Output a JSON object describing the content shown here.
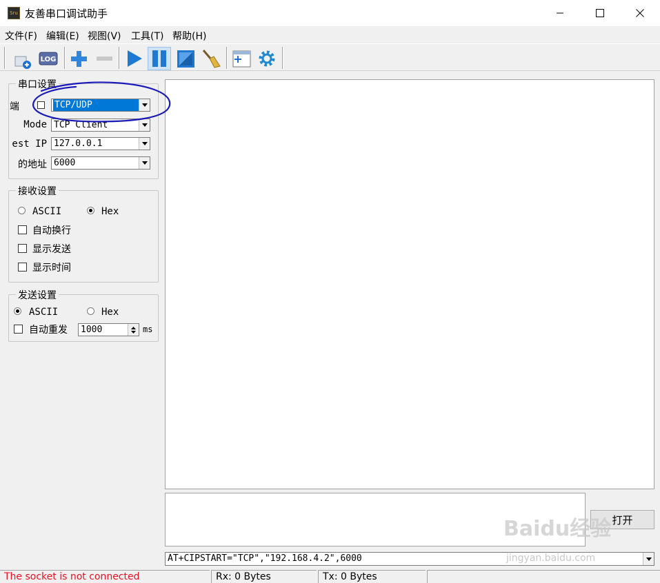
{
  "window": {
    "title": "友善串口调试助手",
    "icon_text": "Sru"
  },
  "menu": {
    "items": [
      "文件(F)",
      "编辑(E)",
      "视图(V)",
      "工具(T)",
      "帮助(H)"
    ]
  },
  "toolbar": {
    "icons": [
      "new-window-icon",
      "log-icon",
      "plus-icon",
      "minus-icon",
      "play-icon",
      "pause-icon",
      "window-icon",
      "broom-icon",
      "layout-icon",
      "settings-gear-icon"
    ],
    "log_label": "LOG"
  },
  "serial_settings": {
    "title": "串口设置",
    "port_label": "端",
    "port_value": "TCP/UDP",
    "mode_label": "Mode",
    "mode_value": "TCP Client",
    "ip_label": "est IP",
    "ip_value": "127.0.0.1",
    "addr_label": "的地址",
    "addr_value": "6000"
  },
  "receive_settings": {
    "title": "接收设置",
    "ascii_label": "ASCII",
    "hex_label": "Hex",
    "selected": "Hex",
    "auto_wrap": "自动换行",
    "show_send": "显示发送",
    "show_time": "显示时间"
  },
  "send_settings": {
    "title": "发送设置",
    "ascii_label": "ASCII",
    "hex_label": "Hex",
    "selected": "ASCII",
    "auto_resend": "自动重发",
    "interval_value": "1000",
    "interval_unit": "ms"
  },
  "main": {
    "open_button": "打开",
    "command_value": "AT+CIPSTART=\"TCP\",\"192.168.4.2\",6000"
  },
  "status": {
    "message": "The socket is not connected",
    "rx": "Rx: 0 Bytes",
    "tx": "Tx: 0 Bytes"
  },
  "colors": {
    "status_error": "#e81123",
    "selection": "#0078d7",
    "annotation": "#1a1ab8"
  },
  "watermark": {
    "brand": "Baidu经验",
    "url": "jingyan.baidu.com"
  }
}
